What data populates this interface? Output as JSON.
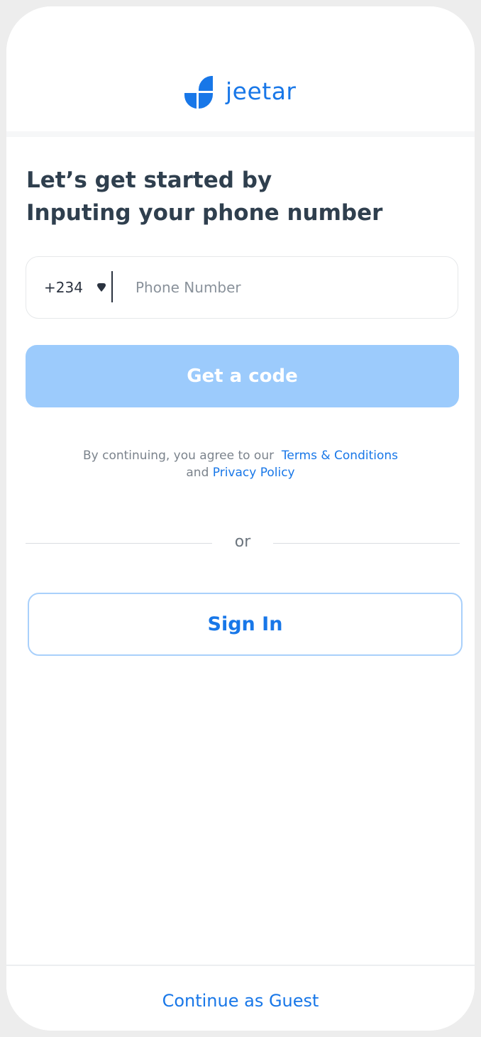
{
  "brand": {
    "name": "jeetar",
    "color": "#1877e8"
  },
  "heading": {
    "line1": "Let’s get started by",
    "line2": "Inputing your phone number"
  },
  "phone_field": {
    "country_code": "+234",
    "placeholder": "Phone Number",
    "value": ""
  },
  "actions": {
    "get_code_label": "Get a code",
    "get_code_color": "#9ccbfc",
    "or_label": "or",
    "sign_in_label": "Sign In",
    "guest_label": "Continue as Guest"
  },
  "legal": {
    "prefix": "By continuing, you agree to our",
    "terms_link": "Terms & Conditions",
    "conjunction": "and",
    "privacy_link": "Privacy Policy"
  },
  "icons": {
    "logo": "jeetar-logo-icon",
    "dropdown": "caret-down-icon"
  }
}
